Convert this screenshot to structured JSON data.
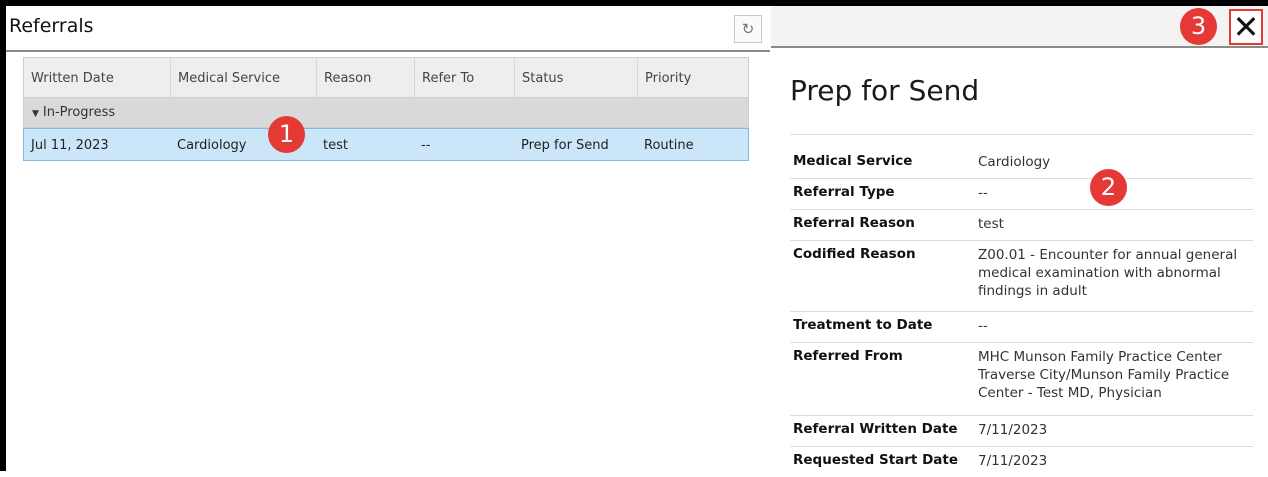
{
  "left_panel": {
    "title": "Referrals",
    "refresh_icon": "refresh-icon",
    "columns": [
      "Written Date",
      "Medical Service",
      "Reason",
      "Refer To",
      "Status",
      "Priority"
    ],
    "group": "In-Progress",
    "rows": [
      {
        "written_date": "Jul 11, 2023",
        "medical_service": "Cardiology",
        "reason": "test",
        "refer_to": "--",
        "status": "Prep for Send",
        "priority": "Routine"
      }
    ]
  },
  "right_panel": {
    "title": "Prep for Send",
    "close_icon": "close-icon",
    "details": [
      {
        "label": "Medical Service",
        "value": "Cardiology"
      },
      {
        "label": "Referral Type",
        "value": "--"
      },
      {
        "label": "Referral Reason",
        "value": "test"
      },
      {
        "label": "Codified Reason",
        "value": "Z00.01 - Encounter for annual general medical examination with abnormal findings in adult"
      },
      {
        "label": "Treatment to Date",
        "value": "--"
      },
      {
        "label": "Referred From",
        "value": "MHC Munson Family Practice Center Traverse City/Munson Family Practice Center - Test MD, Physician"
      },
      {
        "label": "Referral Written Date",
        "value": "7/11/2023"
      },
      {
        "label": "Requested Start Date",
        "value": "7/11/2023"
      }
    ]
  },
  "callouts": [
    "1",
    "2",
    "3"
  ],
  "colors": {
    "selected_row": "#cce6f9",
    "callout": "#e53935",
    "group_row": "#d9d9d9"
  }
}
